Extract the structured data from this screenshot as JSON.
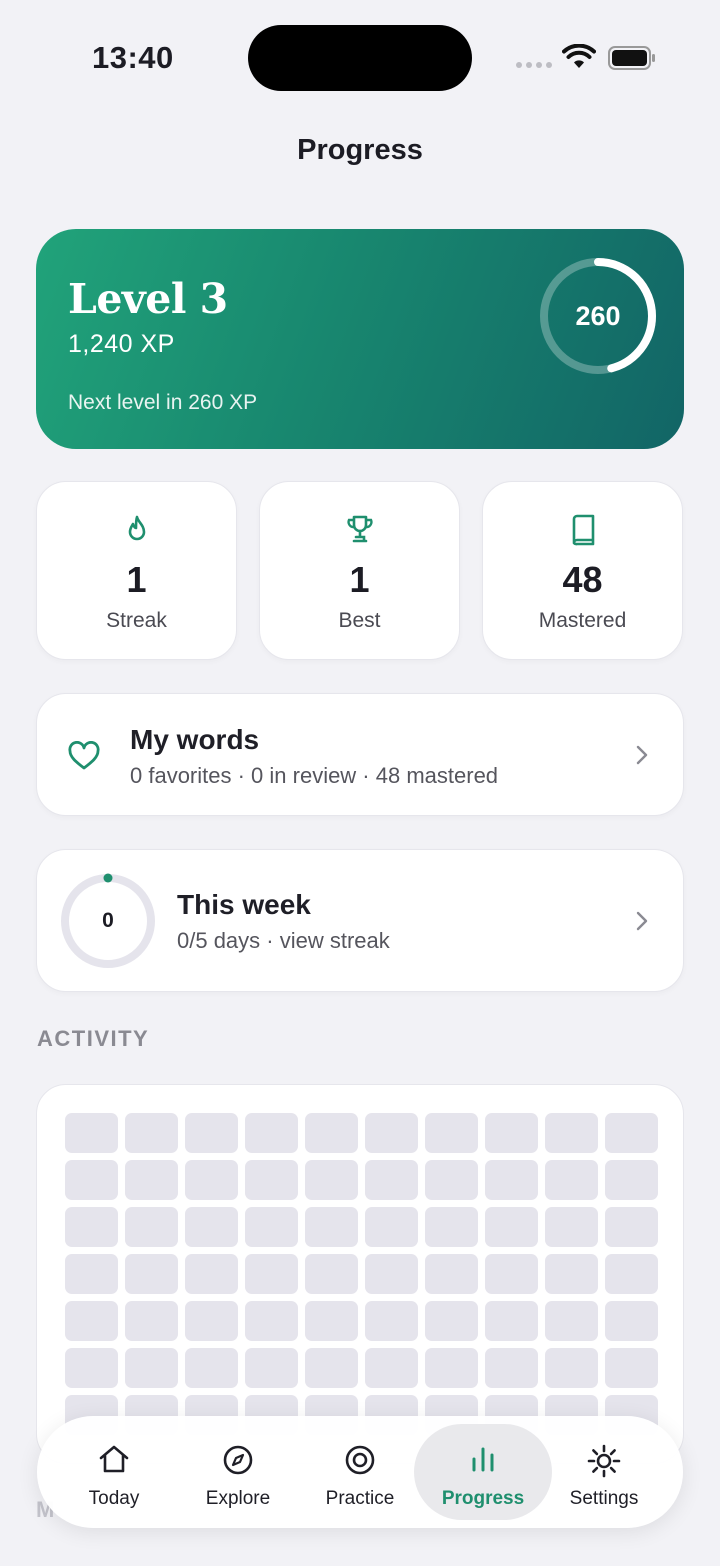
{
  "status_bar": {
    "time": "13:40"
  },
  "header": {
    "title": "Progress"
  },
  "level_card": {
    "title": "Level 3",
    "xp": "1,240 XP",
    "next_level": "Next level in 260 XP",
    "ring_value": "260",
    "ring_progress": 0.46
  },
  "stats": [
    {
      "icon": "flame-icon",
      "value": "1",
      "label": "Streak"
    },
    {
      "icon": "trophy-icon",
      "value": "1",
      "label": "Best"
    },
    {
      "icon": "book-icon",
      "value": "48",
      "label": "Mastered"
    }
  ],
  "my_words": {
    "title": "My words",
    "subtitle": "0 favorites · 0 in review · 48 mastered",
    "icon": "heart-icon"
  },
  "this_week": {
    "title": "This week",
    "subtitle": "0/5 days · view streak",
    "ring_value": "0",
    "progress": 0
  },
  "activity": {
    "section_label": "ACTIVITY",
    "columns": 10,
    "rows": 7
  },
  "tab_bar": {
    "items": [
      {
        "label": "Today",
        "icon": "home-icon",
        "active": false
      },
      {
        "label": "Explore",
        "icon": "compass-icon",
        "active": false
      },
      {
        "label": "Practice",
        "icon": "target-icon",
        "active": false
      },
      {
        "label": "Progress",
        "icon": "bar-chart-icon",
        "active": true
      },
      {
        "label": "Settings",
        "icon": "gear-icon",
        "active": false
      }
    ]
  },
  "colors": {
    "accent": "#1f8f6e",
    "card_gradient_start": "#21a37a",
    "card_gradient_end": "#126566",
    "background": "#f2f2f6"
  }
}
